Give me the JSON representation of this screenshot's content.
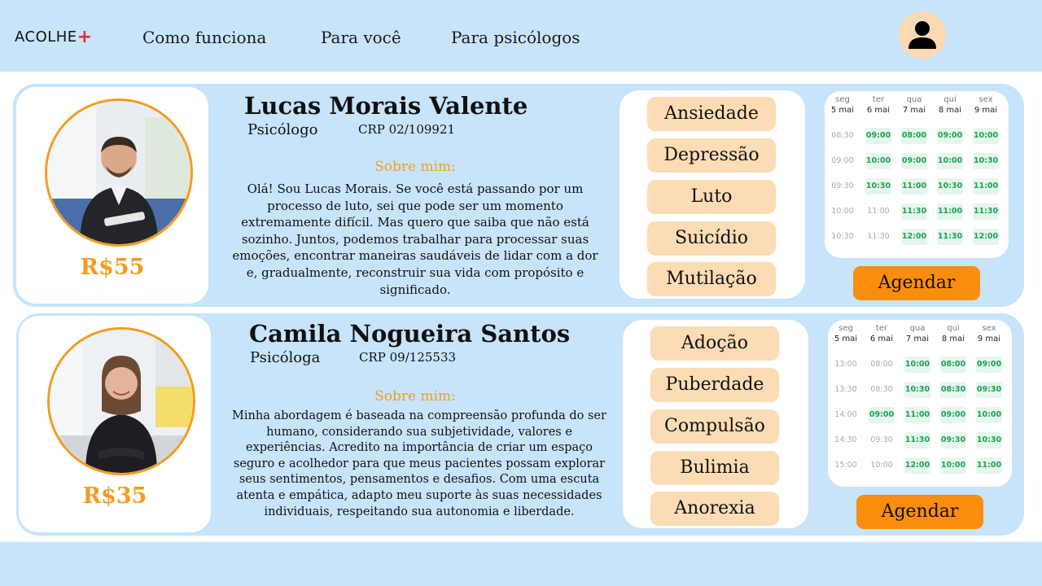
{
  "nav": {
    "logo": "ACOLHE",
    "logo_symbol": "+",
    "links": [
      "Como funciona",
      "Para você",
      "Para psicólogos"
    ]
  },
  "colors": {
    "header_bg": "#c7e4fb",
    "accent": "#f39c1f",
    "button": "#fb8d0e",
    "tag_bg": "#fcdcb4",
    "slot_available": "#1aa352"
  },
  "professionals": [
    {
      "name": "Lucas Morais Valente",
      "role": "Psicólogo",
      "crp": "CRP 02/109921",
      "price": "R$55",
      "about_title": "Sobre mim:",
      "about_lines": [
        "Olá! Sou Lucas Morais. Se você está passando por um",
        "processo de luto, sei que pode ser um momento",
        "extremamente difícil. Mas quero que saiba que não está",
        "sozinho. Juntos, podemos trabalhar para processar suas",
        "emoções, encontrar maneiras saudáveis de lidar com a dor",
        "e, gradualmente, reconstruir sua vida com propósito e",
        "significado."
      ],
      "tags": [
        "Ansiedade",
        "Depressão",
        "Luto",
        "Suicídio",
        "Mutilação"
      ],
      "schedule": {
        "days": [
          {
            "name": "seg",
            "date": "5 mai"
          },
          {
            "name": "ter",
            "date": "6 mai"
          },
          {
            "name": "qua",
            "date": "7 mai"
          },
          {
            "name": "qui",
            "date": "8 mai"
          },
          {
            "name": "sex",
            "date": "9 mai"
          }
        ],
        "columns": [
          [
            {
              "t": "08:30",
              "a": false
            },
            {
              "t": "09:00",
              "a": false
            },
            {
              "t": "09:30",
              "a": false
            },
            {
              "t": "10:00",
              "a": false
            },
            {
              "t": "10:30",
              "a": false
            }
          ],
          [
            {
              "t": "09:00",
              "a": true
            },
            {
              "t": "10:00",
              "a": true
            },
            {
              "t": "10:30",
              "a": true
            },
            {
              "t": "11:00",
              "a": false
            },
            {
              "t": "11:30",
              "a": false
            }
          ],
          [
            {
              "t": "08:00",
              "a": true
            },
            {
              "t": "09:00",
              "a": true
            },
            {
              "t": "11:00",
              "a": true
            },
            {
              "t": "11:30",
              "a": true
            },
            {
              "t": "12:00",
              "a": true
            }
          ],
          [
            {
              "t": "09:00",
              "a": true
            },
            {
              "t": "10:00",
              "a": true
            },
            {
              "t": "10:30",
              "a": true
            },
            {
              "t": "11:00",
              "a": true
            },
            {
              "t": "11:30",
              "a": true
            }
          ],
          [
            {
              "t": "10:00",
              "a": true
            },
            {
              "t": "10:30",
              "a": true
            },
            {
              "t": "11:00",
              "a": true
            },
            {
              "t": "11:30",
              "a": true
            },
            {
              "t": "12:00",
              "a": true
            }
          ]
        ]
      },
      "button": "Agendar"
    },
    {
      "name": "Camila Nogueira Santos",
      "role": "Psicóloga",
      "crp": "CRP 09/125533",
      "price": "R$35",
      "about_title": "Sobre mim:",
      "about_lines": [
        "Minha abordagem é baseada na compreensão profunda do ser",
        "humano, considerando sua subjetividade, valores e",
        "experiências. Acredito na importância de criar um espaço",
        "seguro e acolhedor para que meus pacientes possam explorar",
        "seus sentimentos, pensamentos e desafios. Com uma escuta",
        "atenta e empática, adapto meu suporte às suas necessidades",
        "individuais, respeitando sua autonomia e liberdade."
      ],
      "tags": [
        "Adoção",
        "Puberdade",
        "Compulsão",
        "Bulimia",
        "Anorexia"
      ],
      "schedule": {
        "days": [
          {
            "name": "seg",
            "date": "5 mai"
          },
          {
            "name": "ter",
            "date": "6 mai"
          },
          {
            "name": "qua",
            "date": "7 mai"
          },
          {
            "name": "qui",
            "date": "8 mai"
          },
          {
            "name": "sex",
            "date": "9 mai"
          }
        ],
        "columns": [
          [
            {
              "t": "13:00",
              "a": false
            },
            {
              "t": "13:30",
              "a": false
            },
            {
              "t": "14:00",
              "a": false
            },
            {
              "t": "14:30",
              "a": false
            },
            {
              "t": "15:00",
              "a": false
            }
          ],
          [
            {
              "t": "08:00",
              "a": false
            },
            {
              "t": "08:30",
              "a": false
            },
            {
              "t": "09:00",
              "a": true
            },
            {
              "t": "09:30",
              "a": false
            },
            {
              "t": "10:00",
              "a": false
            }
          ],
          [
            {
              "t": "10:00",
              "a": true
            },
            {
              "t": "10:30",
              "a": true
            },
            {
              "t": "11:00",
              "a": true
            },
            {
              "t": "11:30",
              "a": true
            },
            {
              "t": "12:00",
              "a": true
            }
          ],
          [
            {
              "t": "08:00",
              "a": true
            },
            {
              "t": "08:30",
              "a": true
            },
            {
              "t": "09:00",
              "a": true
            },
            {
              "t": "09:30",
              "a": true
            },
            {
              "t": "10:00",
              "a": true
            }
          ],
          [
            {
              "t": "09:00",
              "a": true
            },
            {
              "t": "09:30",
              "a": true
            },
            {
              "t": "10:00",
              "a": true
            },
            {
              "t": "10:30",
              "a": true
            },
            {
              "t": "11:00",
              "a": true
            }
          ]
        ]
      },
      "button": "Agendar"
    }
  ]
}
